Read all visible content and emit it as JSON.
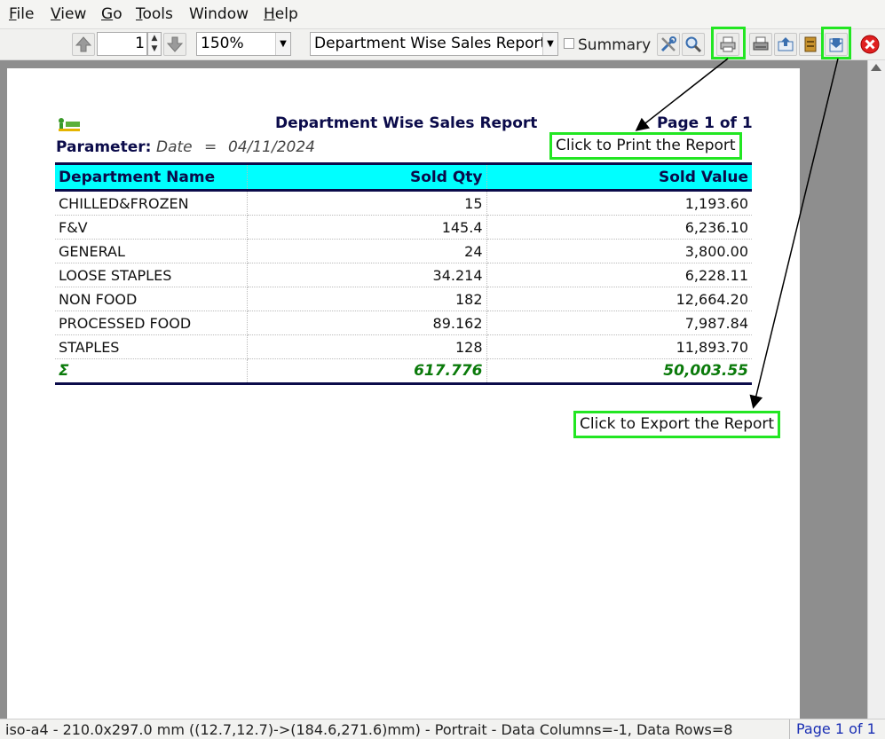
{
  "menu": {
    "items": [
      {
        "label": "File",
        "mnemonic": "F",
        "rest": "ile"
      },
      {
        "label": "View",
        "mnemonic": "V",
        "rest": "iew"
      },
      {
        "label": "Go",
        "mnemonic": "G",
        "rest": "o"
      },
      {
        "label": "Tools",
        "mnemonic": "T",
        "rest": "ools"
      },
      {
        "label": "Window",
        "mnemonic": "",
        "rest": "Window"
      },
      {
        "label": "Help",
        "mnemonic": "H",
        "rest": "elp"
      }
    ]
  },
  "toolbar": {
    "page_number": "1",
    "zoom": "150%",
    "report_select": "Department Wise Sales Report",
    "summary_label": "Summary",
    "summary_checked": false,
    "icons": [
      "up-arrow-icon",
      "down-arrow-icon",
      "tools-icon",
      "zoom-icon",
      "print-icon",
      "print-setup-icon",
      "send-icon",
      "archive-icon",
      "export-icon",
      "close-icon"
    ]
  },
  "report": {
    "title": "Department Wise Sales Report",
    "page_info": "Page 1 of 1",
    "parameter_label": "Parameter:",
    "parameter_name": "Date",
    "parameter_op": "=",
    "parameter_value": "04/11/2024",
    "columns": [
      "Department Name",
      "Sold Qty",
      "Sold Value"
    ],
    "rows": [
      [
        "CHILLED&FROZEN",
        "15",
        "1,193.60"
      ],
      [
        "F&V",
        "145.4",
        "6,236.10"
      ],
      [
        "GENERAL",
        "24",
        "3,800.00"
      ],
      [
        "LOOSE STAPLES",
        "34.214",
        "6,228.11"
      ],
      [
        "NON FOOD",
        "182",
        "12,664.20"
      ],
      [
        "PROCESSED FOOD",
        "89.162",
        "7,987.84"
      ],
      [
        "STAPLES",
        "128",
        "11,893.70"
      ]
    ],
    "total": {
      "symbol": "Σ",
      "qty": "617.776",
      "value": "50,003.55"
    }
  },
  "callouts": {
    "print": "Click to Print the Report",
    "export": "Click to Export the Report"
  },
  "statusbar": {
    "info": "iso-a4 - 210.0x297.0 mm ((12.7,12.7)->(184.6,271.6)mm) - Portrait - Data Columns=-1, Data Rows=8",
    "page": "Page 1 of 1"
  },
  "colors": {
    "header_bg": "#00ffff",
    "title_color": "#0b0b4a",
    "total_color": "#0a7a0a",
    "highlight": "#22e622",
    "status_page": "#1a2fb4"
  }
}
